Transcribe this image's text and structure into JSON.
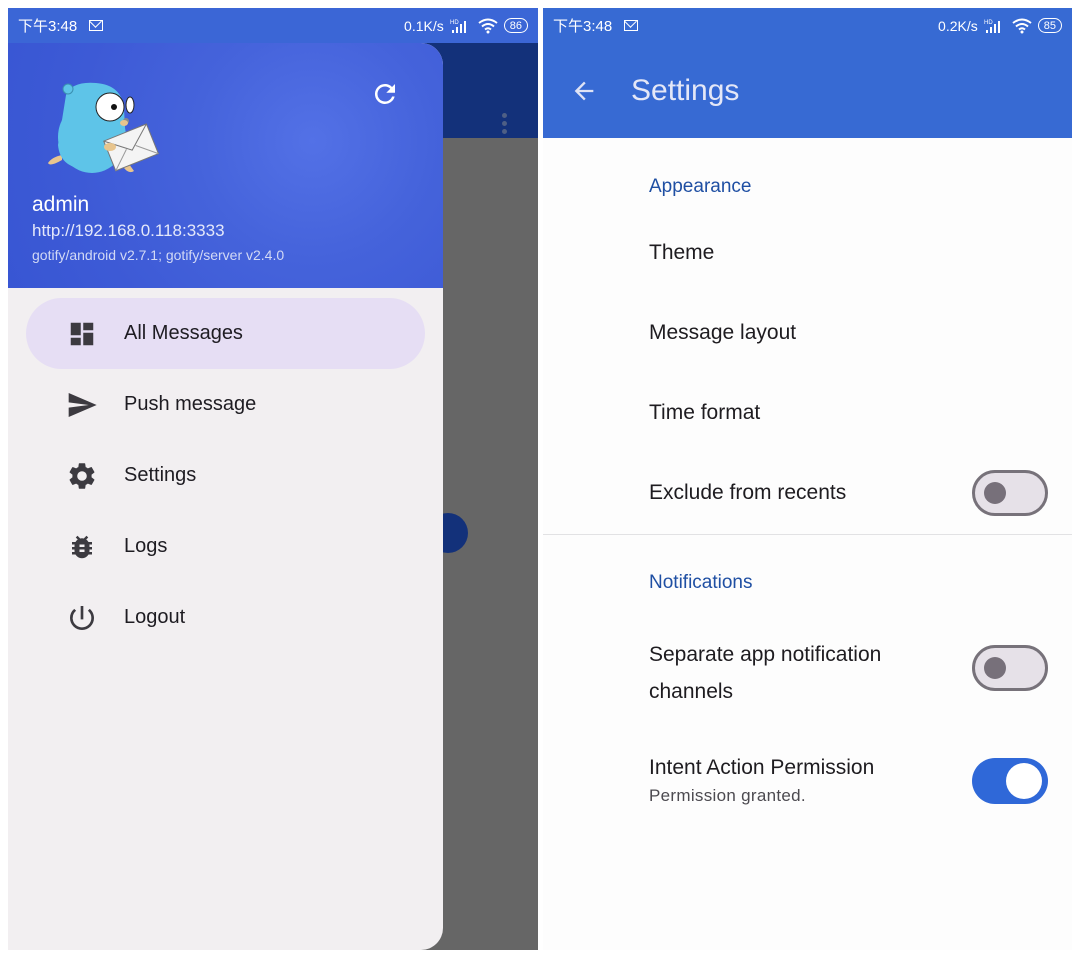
{
  "left_screen": {
    "status_bar": {
      "time": "下午3:48",
      "net_speed": "0.1K/s",
      "network_badge": "HD",
      "battery": "86",
      "icons": [
        "mail-icon",
        "signal-icon",
        "wifi-icon",
        "battery-icon"
      ]
    },
    "drawer": {
      "header": {
        "logo": "gotify-gopher-logo",
        "username": "admin",
        "server_url": "http://192.168.0.118:3333",
        "versions": "gotify/android v2.7.1; gotify/server v2.4.0",
        "refresh_icon": "refresh-icon"
      },
      "items": [
        {
          "label": "All Messages",
          "icon": "dashboard-icon",
          "active": true
        },
        {
          "label": "Push message",
          "icon": "send-icon",
          "active": false
        },
        {
          "label": "Settings",
          "icon": "gear-icon",
          "active": false
        },
        {
          "label": "Logs",
          "icon": "bug-icon",
          "active": false
        },
        {
          "label": "Logout",
          "icon": "power-icon",
          "active": false
        }
      ]
    },
    "background_app": {
      "menu_icon": "more-vert-icon"
    }
  },
  "right_screen": {
    "status_bar": {
      "time": "下午3:48",
      "net_speed": "0.2K/s",
      "network_badge": "HD",
      "battery": "85",
      "icons": [
        "mail-icon",
        "signal-icon",
        "wifi-icon",
        "battery-icon"
      ]
    },
    "appbar": {
      "back_icon": "arrow-back-icon",
      "title": "Settings"
    },
    "sections": [
      {
        "title": "Appearance",
        "items": [
          {
            "label": "Theme"
          },
          {
            "label": "Message layout"
          },
          {
            "label": "Time format"
          },
          {
            "label": "Exclude from recents",
            "switch": false
          }
        ]
      },
      {
        "title": "Notifications",
        "items": [
          {
            "label": "Separate app notification channels",
            "switch": false
          },
          {
            "label": "Intent Action Permission",
            "summary": "Permission granted.",
            "switch": true
          }
        ]
      }
    ],
    "colors": {
      "primary": "#376ad3",
      "section_title": "#1f4fa3",
      "switch_on": "#2f68d8",
      "drawer_active_bg": "#e6def4"
    }
  }
}
